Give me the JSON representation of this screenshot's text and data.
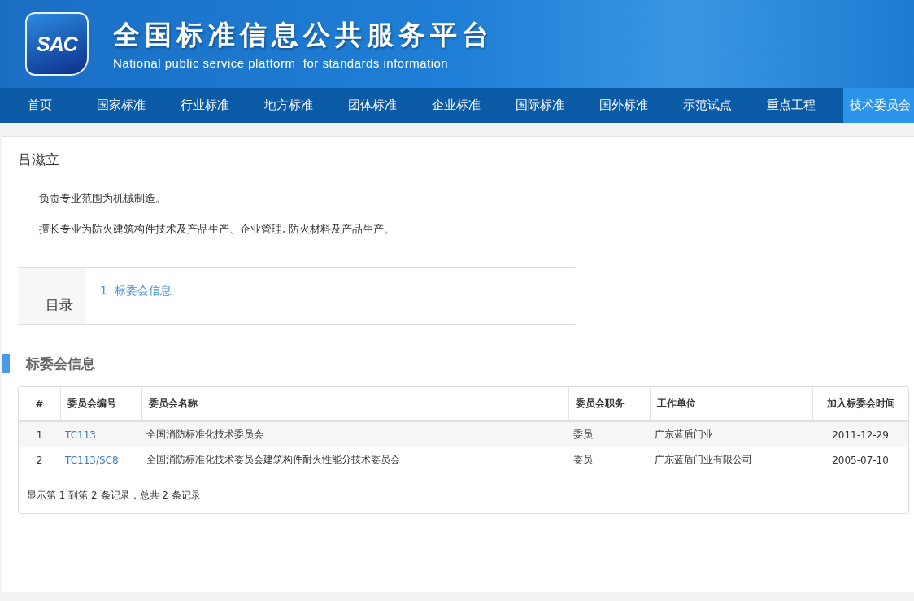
{
  "header": {
    "logo": "SAC",
    "title": "全国标准信息公共服务平台",
    "subtitle": "National public service platform  for standards information"
  },
  "nav": [
    {
      "label": "首页",
      "selected": false
    },
    {
      "label": "国家标准",
      "selected": false
    },
    {
      "label": "行业标准",
      "selected": false
    },
    {
      "label": "地方标准",
      "selected": false
    },
    {
      "label": "团体标准",
      "selected": false
    },
    {
      "label": "企业标准",
      "selected": false
    },
    {
      "label": "国际标准",
      "selected": false
    },
    {
      "label": "国外标准",
      "selected": false
    },
    {
      "label": "示范试点",
      "selected": false
    },
    {
      "label": "重点工程",
      "selected": false
    },
    {
      "label": "技术委员会",
      "selected": true
    }
  ],
  "person": {
    "name": "吕滋立",
    "paragraphs": [
      "负责专业范围为机械制造。",
      "擅长专业为防火建筑构件技术及产品生产、企业管理, 防火材料及产品生产。"
    ]
  },
  "toc": {
    "label": "目录",
    "items": [
      "1  标委会信息"
    ]
  },
  "section": {
    "title": "标委会信息"
  },
  "table": {
    "columns": [
      "#",
      "委员会编号",
      "委员会名称",
      "委员会职务",
      "工作单位",
      "加入标委会时间"
    ],
    "rows": [
      [
        "1",
        "TC113",
        "全国消防标准化技术委员会",
        "委员",
        "广东蓝盾门业",
        "2011-12-29"
      ],
      [
        "2",
        "TC113/SC8",
        "全国消防标准化技术委员会建筑构件耐火性能分技术委员会",
        "委员",
        "广东蓝盾门业有限公司",
        "2005-07-10"
      ]
    ],
    "footer": "显示第 1 到第 2 条记录，总共 2 条记录"
  }
}
